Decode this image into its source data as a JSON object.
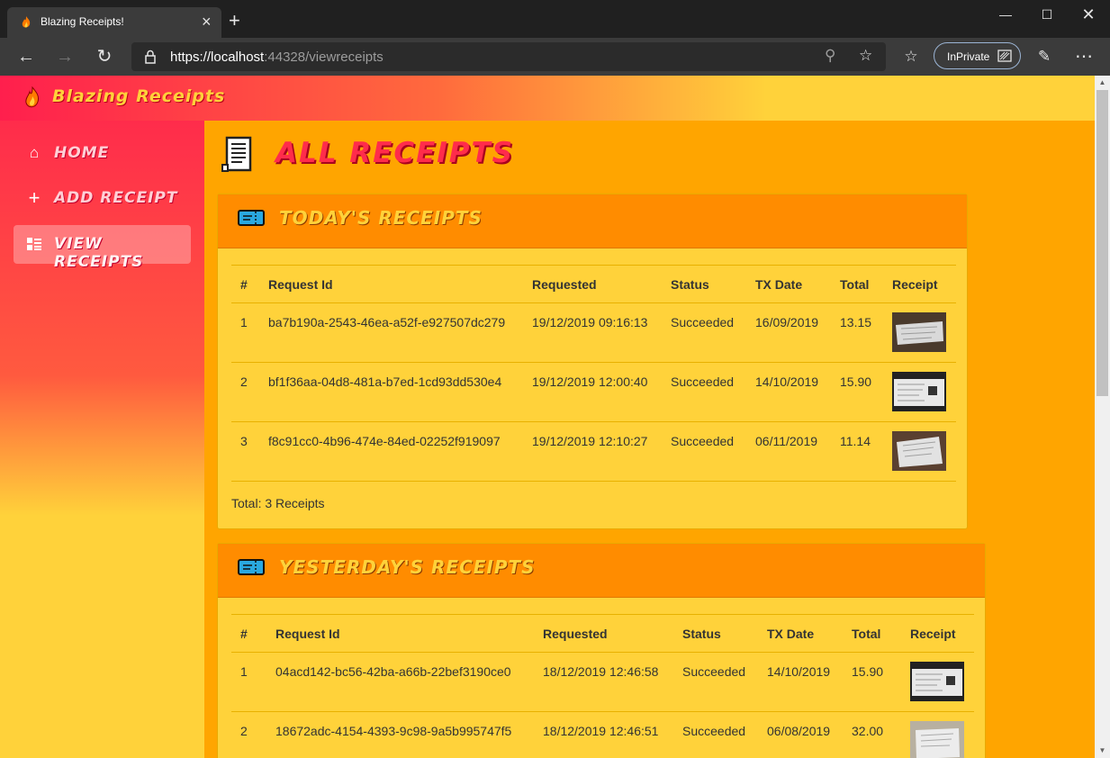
{
  "browser": {
    "tab_title": "Blazing Receipts!",
    "url_prefix": "https://localhost",
    "url_port_path": ":44328/viewreceipts",
    "inprivate_label": "InPrivate"
  },
  "site": {
    "brand": "Blazing Receipts",
    "nav": [
      {
        "label": "Home",
        "icon": "home-icon"
      },
      {
        "label": "Add Receipt",
        "icon": "plus-icon"
      },
      {
        "label": "View Receipts",
        "icon": "list-icon"
      }
    ],
    "page_title": "All Receipts"
  },
  "columns": [
    "#",
    "Request Id",
    "Requested",
    "Status",
    "TX Date",
    "Total",
    "Receipt"
  ],
  "today": {
    "title": "Today's Receipts",
    "rows": [
      {
        "num": "1",
        "request_id": "ba7b190a-2543-46ea-a52f-e927507dc279",
        "requested": "19/12/2019 09:16:13",
        "status": "Succeeded",
        "tx_date": "16/09/2019",
        "total": "13.15"
      },
      {
        "num": "2",
        "request_id": "bf1f36aa-04d8-481a-b7ed-1cd93dd530e4",
        "requested": "19/12/2019 12:00:40",
        "status": "Succeeded",
        "tx_date": "14/10/2019",
        "total": "15.90"
      },
      {
        "num": "3",
        "request_id": "f8c91cc0-4b96-474e-84ed-02252f919097",
        "requested": "19/12/2019 12:10:27",
        "status": "Succeeded",
        "tx_date": "06/11/2019",
        "total": "11.14"
      }
    ],
    "total_text": "Total: 3 Receipts"
  },
  "yesterday": {
    "title": "Yesterday's Receipts",
    "rows": [
      {
        "num": "1",
        "request_id": "04acd142-bc56-42ba-a66b-22bef3190ce0",
        "requested": "18/12/2019 12:46:58",
        "status": "Succeeded",
        "tx_date": "14/10/2019",
        "total": "15.90"
      },
      {
        "num": "2",
        "request_id": "18672adc-4154-4393-9c98-9a5b995747f5",
        "requested": "18/12/2019 12:46:51",
        "status": "Succeeded",
        "tx_date": "06/08/2019",
        "total": "32.00"
      }
    ]
  },
  "colors": {
    "accent_red": "#ff2c4b",
    "accent_orange": "#ff8c00",
    "accent_yellow": "#ffd23a",
    "page_bg": "#ffa500"
  }
}
